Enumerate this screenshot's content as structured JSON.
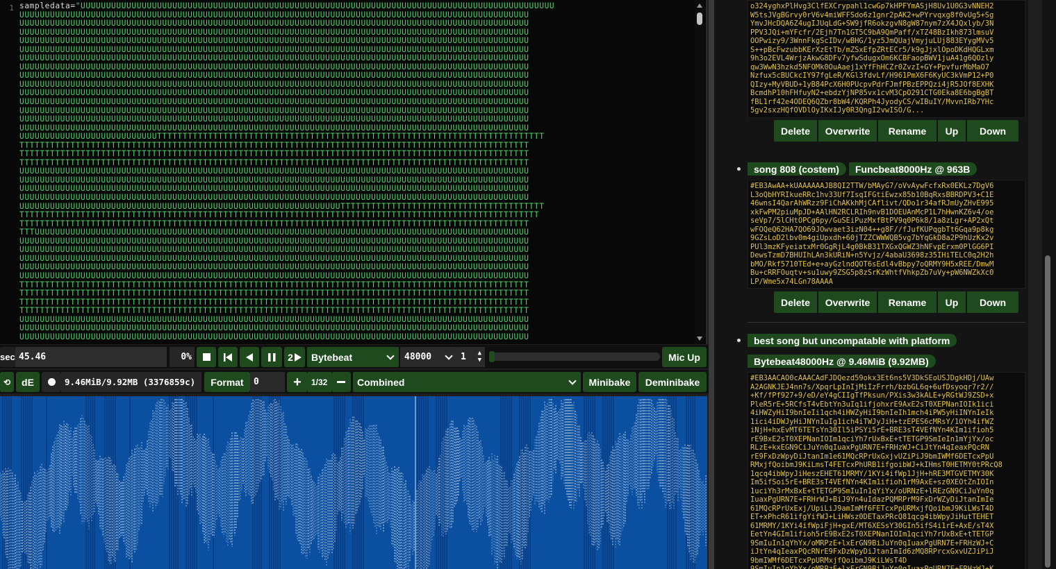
{
  "editor": {
    "line_number": "1",
    "code_lines": [
      "sampledata=\"UUUUUUUUUUUUUUUUUUUUUUUUUUUUUUUUUUUUUUUUUUUUUUUUUUUUUUUUUUUUUUUUUUUUUUUUUUUUUUUUUUUUUUUUUUUUU",
      "UUUUUUUUUUUUUUUUUUUUUUUUUUUUUUUUUUUUUUUUUUUUUUUUUUUUUUUUUUUUUUUUUUUUUUUUUUUUUUUUUUUUUUUUUUUUUUUUUUUU",
      "UUUUUUUUUUUUUUUUUUUUUUUUUUUUUUUUUUUUUUUUUUUUUUUUUUUUUUUUUUUUUUUUUUUUUUUUUUUUUUUUUUUUUUUUUUUUUUUUUUUU",
      "UUUUUUUUUUUUUUUUUUUUUUUUUUUUUUUUUUUUUUUUUUUUUUUUUUUUUUUUUUUUUUUUUUUUUUUUUUUUUUUUUUUUUUUUUUUUUUUUUUUU",
      "UUUUUUUUUUUUUUUUUUUUUUUUUUUUUUUUUUUUUUUUUUUUUUUUUUUUUUUUUUUUUUUUUUUUUUUUUUUUUUUUUUUUUUUUUUUUUUUUUUUU",
      "UUUUUUUUUUUUUUUUUUUUUUUUUUUUUUUUUUUUUUUUUUUUUUUUUUUUUUUUUUUUUUUUUUUUUUUUUUUUUUUUUUUUUUUUUUUUUUUUUUUU",
      "UUUUUUUUUUUUUUUUUUUUUUUUUUUUUUUUUUUUUUUUUUUUUUUUUUUUUUUUUUUUUUUUUUUUUUUUUUUUUUUUUUUUUUUUUUUUUUUUUUUU",
      "UUUUUUUUUUUUUUUUUUUUUUUUUUUUUUUUUUUUUUUUUUUUUUUUUUUUUUUUUUUUUUUUUUUUUUUUUUUUUUUUUUUUUUUUUUUUUUUUUUUU",
      "UUUUUUUUUUUUUUUUUUUUUUUUUUUUUUUUUUUUUUUUUUUUUUUUUUUUUUUUUUUUUUUUUUUUUUUUUUUUUUUUUUUUUUUUUUUUUUUUUUUU",
      "UUUUUUUUUUUUUUUUUUUUUUUUUUUUUUUUUUUUUUUUUUUUUUUUUUUUUUUUUUUUUUUUUUUUUUUUUUUUUUUUUUUUUUUUUUUUUUUUUUUU",
      "UUUUUUUUUUUUUUUUUUUUUUUUUUUUUUUUUUUUUUUUUUUUUUUUUUUUUUUUUUUUUUUUUUUUUUUUUUUUUUUUUUUUUUUUUUUUUUUUUUUU",
      "UUUUUUUUUUUUUUUUUUUUUUUUUUUUUUUUUUUUUUUUUUUUUUUUUUUUUUUUUUUUUUUUUUUUUUUUUUUUUUUUUUUUUUUUUUUUUUUUUUUU",
      "UUUUUUUUUUUUUUUUUUUUUUUUUUUUUUUUUUUUUUUUUUUUUUUUUUUUUUUUUUUUUUUUUUUUUUUUUUUUUUUUUUUUUUUUUUUUUUUUUUUU",
      "UUUUUUUUUUUUUUUUUUUUUUUUUUUUUUUUUUUUUUUUUUUUUUUUUUUUUUUUUUUUUUUUUUUUUUUUUUUUUUUUUUUUUUUUUUUUUUUUUUUU",
      "UUUUUUUUUUUUUUUUUUUUUUUUUUUUUUUUUUUUUUUUUUUUUUUUUUUUUUUUUUUUUUUUUUUUUUUUUUUUUUUUUUUUUUUUUUUUUUUUUUUU",
      "UUUUUUUUUUUUUUUUUUUUUUUUUUUTTTTTTTTTTTTTTTTTTTTTTTTTTTTTTTTTTTTTTTTTTTTTTTTTTTTTTTTTTTTTTTTTTTTTTTTTTTT",
      "TTTTTTTTTTTTTTTTTTTTTTTTTTTTTTTTTTTTTTTTTTTTTTTTTTTTTTTTTTTTTTTTTTTTTTTTTTTTTTTTTTTTTTTTTTTTTTTTTTTT",
      "TTTTTTTTTTTTTTTTTTTTTTTTTTTTTTTTTTTTTTTTTTTTTTTTTTTTTTTTTTTTTTTTTTTTTTTTTTTTTTTTTTTTTTTTTTTTTTTTTTTT",
      "TTTTTTTTTTTTTTTTTTTTTTTTTTTTTTTTTTTTTTTTTTTTTTTTTTTTTTTTTTTTTTTTTTTTTTTTTTTTTTTTTTTTTTTTTTTTTTTTTTTT",
      "UUUUUUUUUUUUUUUUUUUUUUUUUUUUUUUUUUUUUUUUUUUUUUUUUUUUUUUUUUUUUUUUUUUUUUUUUUUUUUUUUUUUUUUUUUUUUUUUUUUU",
      "UUUUUUUUUUUUUUUUUUUUUUUUUUUUUUUUUUUUUUUUUUUUUUUUUUUUUUUUUUUUUUUUUUUUUUUUUUUUUUUUUUUUUUUUUUUUUUUUUUUU",
      "UUUUUUUUUUUUUUUUUUUUUUUUUUUUUUUUUUUUUUUUUUUUUUUUUUUUUUUUUUUUUUUUUUUUUUUUUUUUUUUUUUUUUUUUUUUUUUUUUUUU",
      "UUUUUUUUUUUUUUUUUUUUUUUUUUUUUUUUUUUUUUUUUUUUUUUUUUUUUUUUUUUUUUUUUUUUUUUUUUUUUUUUUUUUUUUUUUUUUUUUUUUU",
      "UUUUUUUUUUUUUUUUUUUUUUUUUUUUUUUUUUUUUUUUUUUUUUUUUUUUUUUUUUUUUUUTTTTTTTTTTTTTTTTTTTTTTTTTTTTTTTTTTTTTTTT",
      "TTTTTTTTTTTTTTTTTTTTTTTTTTTTTTTTTTTTTTTTTTTTTTTTTTTTTTTTTTTTTTTTTTTTTTTTTTTTTTTTTTTTTTTTTTTTTTTTTTTTTT",
      "TTTTTTTTTTTTTTTTTTTTTTTTTTTTTTTTTTTTTTTTTTTTTTTTTTTTTTTTTTTTTTTTTTTTTTTTTTTTTTTTTTTTTTTTTTTTTTTTTTTT",
      "TTTUUUUUUUUUUUUUUUUUUUUUUUUUUUUUUUUUUUUUUUUUUUUUUUUUUUUUUUUUUUUUUUUUUUUUUUUUUUUUUUUUUUUUUUUUUUUUUUUU",
      "UUUUUUUUUUUUUUUUUUUUUUUUUUUUUUUUUUUUUUUUUUUUUUUUUUUUUUUUUUUUUUUUUUUUUUUUUUUUUUUUUUUUUUUUUUUUUUUUUUUU",
      "UUUUUUUUUUUUUUUUUUUUUUUUUUUUUUUUUUUUUUUUUUUUUUUUUUUUUUUUUUUUUUUUUUUUUUUUUUUUUUUUUUUUUUUUUUUUUUUUUUUU",
      "UUUUUUUUUUUUUUUUUUUUUUUUUUUUUUUUUUUUUUUUUUUUUUUUUUUUUUUUUUUUUUUUUUUUUUUUUUUUUUUUUUUUUUUUUUUUUUUUUUUU",
      "UUUUUUUUUUUUUUUUUUUUUUUUUUUUUUUUUUUUUUUUUUUUUUUUUUUUUUUUUUUUUUUUUUUUUUUUUUUUUUUUUUUUUUUUUUUUUUUUUUUU",
      "UUUUUUUUUUUUUUUUUUUUUUUUUUUUUUUUUUUUUUUUUUUUUUUUUUUUUUUUUUUUUUUUUUUUUUUUUUUUUUUUUUUUUUUUUUUUUUUUUUUU",
      "TTTTTTTTTTTTTTTTTTTTTTTTTTTTTTTTTTTTTTTTTTTTTTTTTTTTTTTTTTTTTTTTTTTTTTTTTTTTTTTTTTTTTTTTTTTTTTTTTTTT",
      "TTTTTTTTTTTTTTTTTTTTTTTTTTTTTTTTTTTTTTTTTTTTTTTTTTTTTTTTTTTTTTTTTTTTTTTTTTTTTTTTTTTTTTTTTTTTTTTTTTTT",
      "TTTTTTTTTTTTTTTTTTTTTTTTTTTTTTTTTTTTTTTTTTTTTTTTTTTTTTTTTTTTTTTTTTTTTTTTTTTTTTTTTTTTTTTTTTTTTTTTTTTT",
      "TTTTTTTTTTTTTTTTTTTTTTTTTTTTTTTTTTTTTTTTTTTTTTTTTTTTTTTTTTTTTTTTTTTTTTTTTTTTTTTTTTTTTTTTTTTTTTTTTTTT",
      "UUUUUUUUUUUUUUUUUUUUUUUUUUUUUUUUUUUUUUUUUUUUUUUUUUUUUUUUUUUUUUUUUUUUUUUUUUUUUUUUUUUUUUUUUUUUUUUUUUUU",
      "UUUUUUUUUUUUUUUUUUUUUUUUUUUUUUUUUUUUUUUUUUUUUUUUUUUUUUUUUUUUUUUUUUUUUUUUUUUUUUUUUUUUUUUUUUUUUUUUUUUU",
      "UUUUUUUUUUUUUUUUUUUUUUUUUUUUUUUUUUUUUUUUUUUUUUUUUUUUUUUUUUUUUUUUUUUUUUUUUUUUUUUUUUUUUUUUUUUUUUUUUUUU"
    ]
  },
  "row1": {
    "sec_label": "sec",
    "sec_value": "45.46",
    "volume": "0%",
    "speed_label": "2",
    "mode": "Bytebeat",
    "rate": "48000",
    "rate_divisor": "1",
    "mic_button": "Mic Up"
  },
  "row2": {
    "de_label": "dE",
    "size_info": "9.46MiB/9.92MB (3376859c)",
    "format_label": "Format",
    "format_value": "0",
    "zoom": "1/32",
    "view_mode": "Combined",
    "minibake": "Minibake",
    "deminibake": "Deminibake"
  },
  "library": {
    "actions": [
      "Delete",
      "Overwrite",
      "Rename",
      "Up",
      "Down"
    ],
    "entries": [
      {
        "code": "o324yghxPlHvg3ClfEXCrypahl1cwGp7kHPFYmASjH8Uv1U0G3vNNEH2\nW5tsJVgBGrvy0rV6v4miWFFSdo6z1gnr2pAK2+wPYrvqxg8f0vUg5+Sg\nYmvJHcDQA6Z4ugIJUqLdG+SW9jfR6okzgvN8gW87nym7zX4JQxlyb/3N\nPPV3JQi+mYFcfr/2Ejh7Tn1GT5C9bA9QmPaff/xTZ48BzIkh873lmsuV\nOOPwizy9/3WnnFkgScIDv/wBHG/1yz5JmQUajVmyjuLUj883EYygMVv5\nS++pBcFwzubbKErXzEtTb/mZSxEfpZRtECr5/k9gJjxlOpoDKdHQGLxm\n9h3o2EVL4WrjzAkwG8DFv7yfwSdugxOm6KCBFaopBWV1juA41g6QOzly\nqw3WwN3hzkd5NFOMk0OuAaej1xYfFhHCZr0ZvzI+GY+PpvfurMbMaO7\nNzfux5cBUCkcIY97fgLeR/KGl3fdvLf/H961PmX6F6KyUC3kVmP12+P0\nQIzy+MyVBUD+1yB84PcX6H0PUcpvPdrFJmfPBzEPPQzi4jR5JOf8EXHK\nBcmdhP10hFHfuyN2+ebdzYjNP85vx1cvM3CpO291CTG0Eka8E6bgBgBT\nfBL1rf42e4ODEQ6QZbr8bW4/KQRPh4JyodyCS/wIBuIY/MvvnIRb7YHc\n5gv2sxzHQfOVDlOyIKxIJy0R3QngI2vwISO/G..."
      },
      {
        "title": "song 808 (costem)",
        "meta": "Funcbeat8000Hz @ 963B",
        "code": "#EB3AwAA+kUAAAAAAJB8QI2TTW/bMAyG7/oVvAywFcfxRx0EKLz7DgV6\nL3oQbHYRIkueRRc1hv33Uf7IsqIFGtiEwzx85b10BqRxsBBRDPV3+C1E\n46wnsI4QarAhWRzz9FiChAKkhMjCAflivt/QDo1r34afRJmUyZHvE995\nxkFwPM2piuMpJD+AAlHN2RCLRIh9nvB1DOEUAnMcP1L7hHwnKZ6v4/oe\nseVp7/5lCHtOPCg6py/GuSEiPuzMxfBtPV9q0P6k8/1a8zLgr+AP2xQt\nwFOQeQ62HA7QO69JOwvaet3izN04++g8F//fJufKUPqgbTt6Gqa9p8kg\n9GZsLoD2lbv0m4giUpxdh+60jTZZCWWWQB5vg7bYqGkD8a2P9hUzKx2v\nPUl3mzKFyeiatxMr0GgRjL4g0BkB31TXGxQGWZ3hNFvpErxm0PlGG6PI\nDewsTzmD7BHUIhLAn3kURiN+n5Yvjz/4abaU3698z35IHiTELC0q2H2h\nbMO/Rkf5710TEd+e+ayGzlndQOT6sEdl4vBbpy7oQRMY9H5xREE/DmwM\nBu+cRRFOuqtv+su1uwy9ZSG5p8zSrKzWhtfVhkpZb7uVy+pW6NWZkXc0\nLP/Wme5x74LGn78AAAA"
      },
      {
        "title": "best song but uncompatable with platform",
        "meta": "Bytebeat48000Hz @ 9.46MiB (9.92MB)",
        "code": "#EB3AACAO0cAAACAdFJDQezd59okx3Et6ns5V3DkSEoUSJDgkHDj/UAw\nA2AGNKJEJ4nn7s/XpqrLpInIjMiIzFrrh/bzbGL6q+6ufDsyoqr7r2//\n+Kf/fPf927+9/eD/eY4gCIIgTfPksun/PXis3w3kALE+yRGtWJ9ZSD+x\nPleR5rE+5RCfsT4vEbtYn3uIq1ifjohxrE9AxE2sT0XEPNanIOIk1ici\n4iHWZyHiI9bnIeIi1qch4iHWZyHiI9bnIeIh1mch4iPW5yHiINYnIeIk\n1ici4iDWJyHiJNYnIuIg1ich4iTWJyJiH+tzEPES6cMRsY/1OYh4ifWZ\niNjH+hxEvMT6TETsYn30Il5iPSYi5rE+BRE3sT4VEfNYn4KIm1ifioh5\nrE9BxE2sT0XEPNanIOIm1qciYh7rUxBxE+tTETGP9SmIeIn1mYjYx/oc\nRLzE+kxEGN9CiJuYn0qIuaxPgURN7E+FRHzWJ+CiJtYn4qIeaxPQcRN\nrE9FxDzWpyDiJtanIm1e61MQcRPrUxGxjvUZiPiJ9bmIWMf6DETcxPpU\nRMxjfQoibmJ9KiLmsT4FETcxPhURB1ifgoibWJ+kIHmsT0HETMY0tPRcQ8\n1qcq4ibWpyJiHeszEHET61MRMY/1KYi4ifWp1JjH+hRE3MTGVETMY30K\nIm5ifSoi5rE+BRE3sT4VEfNYn4KIm1ifioh1rM9AxE+sz0XEOtZnIOIn\n1uciYh3rMxBxE+tTETGP9SmIuIn1qYiYx/oURNzE+lREzGN9CiJuYn0q\nIuaxPgURN7E+FRHrWJ+BiJ9Yn4uIdazPQMRPrM9FxDrWZyDiJtanImIe\n61MQcRPrUxExj/UpiLiJ9amImMf6FETcxPpURMxjfQoibmJ9KiLWsT4D\nET+xPhcR61ifgYifWJ+LiHWsz0DETaxPRcQ81qcg4ibWpyJiHutTEHET\n61MRMY/1KYi4ifWpiFjH+gxE/MT6XESsY30GIn5ifS4i1rE+AxE/sT4X\nEetYn4GIm1ifioh5rE9BxE2sT0XEPNanIOIm1qciYh7rUxBxE+tTETGP\n9SmIuIn1qYhYx/oMRPzE+lxErGN9BiJuYn0qIuaxPgURN7E+FRHzWJ+C\niJtYn4qIeaxPQcRNrE9FxDzWpyDiJtanImId6zMQ8RPrcxGxvUZJiPiJ\n9bmIWMf6DETcxPpURMxjfQoibmJ9KiLWsT4D\n9SmIuIn1qYhYx/oMRPzE+lxErGN9BiJuYn0qIuaxPgURN7E+FRHzWJ+K"
      }
    ]
  },
  "waveform": {
    "background": "#0a4fa0",
    "trace_color": "#e8eef5",
    "cursor_position": 0.587
  },
  "colors": {
    "button": "#1f4a1e",
    "editor_text": "#4fd26a",
    "library_code": "#e0c14a"
  }
}
